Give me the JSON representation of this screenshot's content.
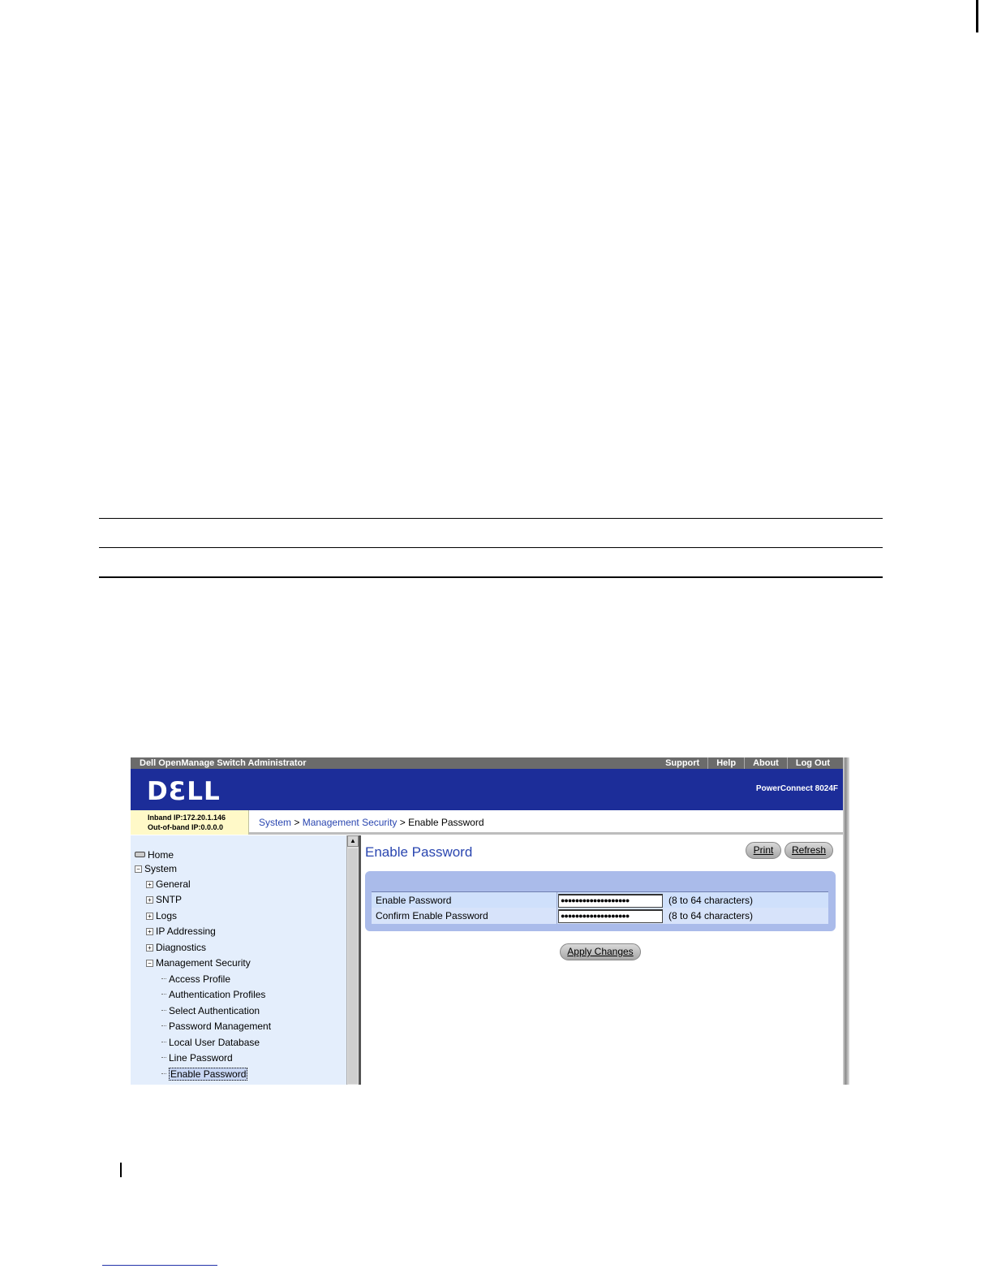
{
  "app": {
    "title": "Dell OpenManage Switch Administrator",
    "top_links": [
      "Support",
      "Help",
      "About",
      "Log Out"
    ],
    "logo": "DƐLL",
    "model": "PowerConnect 8024F"
  },
  "ip": {
    "inband": "Inband IP:172.20.1.146",
    "outband": "Out-of-band IP:0.0.0.0"
  },
  "breadcrumb": {
    "system": "System",
    "sep1": " > ",
    "mgmt": "Management Security",
    "sep2": " > ",
    "current": "Enable Password"
  },
  "nav": {
    "home": "Home",
    "system": "System",
    "general": "General",
    "sntp": "SNTP",
    "logs": "Logs",
    "ip_addressing": "IP Addressing",
    "diagnostics": "Diagnostics",
    "management_security": "Management Security",
    "access_profile": "Access Profile",
    "authentication_profiles": "Authentication Profiles",
    "select_authentication": "Select Authentication",
    "password_management": "Password Management",
    "local_user_database": "Local User Database",
    "line_password": "Line Password",
    "enable_password": "Enable Password"
  },
  "content": {
    "title": "Enable Password",
    "print": "Print",
    "refresh": "Refresh",
    "fields": [
      {
        "label": "Enable Password",
        "value": "●●●●●●●●●●●●●●●●●●●",
        "hint": "(8 to 64 characters)"
      },
      {
        "label": "Confirm Enable Password",
        "value": "●●●●●●●●●●●●●●●●●●●",
        "hint": "(8 to 64 characters)"
      }
    ],
    "apply": "Apply Changes"
  },
  "colors": {
    "banner": "#1c2d99",
    "link": "#2a46b0",
    "panel": "#aabbea",
    "nav_bg": "#e4eefc"
  }
}
